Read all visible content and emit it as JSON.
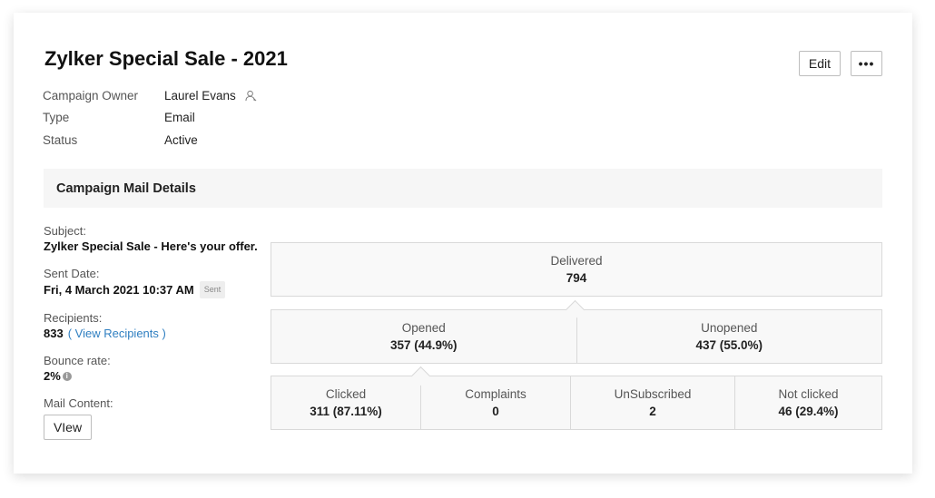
{
  "header": {
    "title": "Zylker Special Sale - 2021",
    "edit_label": "Edit",
    "more_label": "•••"
  },
  "meta": {
    "owner_label": "Campaign Owner",
    "owner_value": "Laurel Evans",
    "type_label": "Type",
    "type_value": "Email",
    "status_label": "Status",
    "status_value": "Active"
  },
  "section": {
    "title": "Campaign Mail Details"
  },
  "details": {
    "subject_label": "Subject:",
    "subject_value": "Zylker Special Sale - Here's your offer.",
    "sent_date_label": "Sent Date:",
    "sent_date_value": "Fri, 4 March 2021 10:37 AM",
    "sent_badge": "Sent",
    "recipients_label": "Recipients:",
    "recipients_value": "833",
    "view_recipients": "( View Recipients )",
    "bounce_label": "Bounce rate:",
    "bounce_value": "2%",
    "info_glyph": "i",
    "mail_content_label": "Mail Content:",
    "view_button": "VIew"
  },
  "stats": {
    "delivered": {
      "label": "Delivered",
      "value": "794"
    },
    "opened": {
      "label": "Opened",
      "value": "357 (44.9%)"
    },
    "unopened": {
      "label": "Unopened",
      "value": "437 (55.0%)"
    },
    "clicked": {
      "label": "Clicked",
      "value": "311 (87.11%)"
    },
    "complaints": {
      "label": "Complaints",
      "value": "0"
    },
    "unsubscribed": {
      "label": "UnSubscribed",
      "value": "2"
    },
    "not_clicked": {
      "label": "Not clicked",
      "value": "46 (29.4%)"
    }
  },
  "icons": {
    "owner": "person-icon",
    "bounce_info": "info-icon"
  },
  "colors": {
    "link": "#2f7fc1",
    "section_bg": "#f6f6f6",
    "stat_bg": "#f8f8f8",
    "border": "#d9d9d9"
  }
}
